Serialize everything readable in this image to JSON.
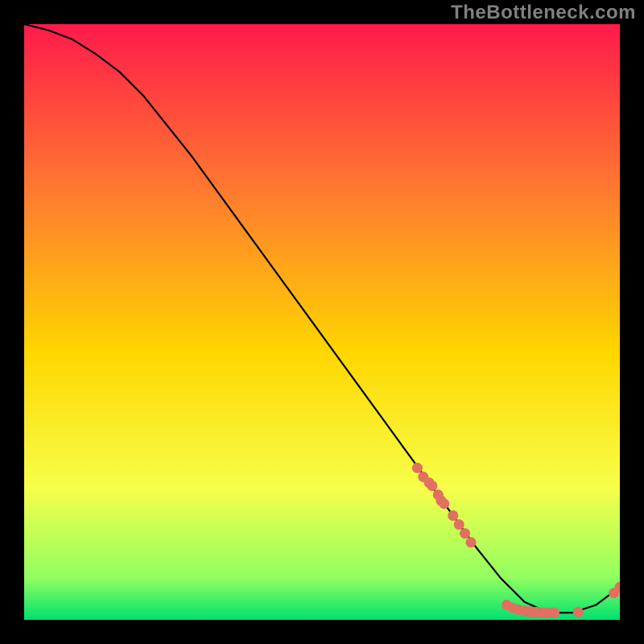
{
  "watermark": "TheBottleneck.com",
  "chart_data": {
    "type": "line",
    "title": "",
    "xlabel": "",
    "ylabel": "",
    "xlim": [
      0,
      100
    ],
    "ylim": [
      0,
      100
    ],
    "grid": false,
    "legend": false,
    "series": [
      {
        "name": "curve",
        "kind": "line",
        "color": "#000000",
        "x": [
          0,
          4,
          8,
          12,
          16,
          20,
          24,
          28,
          32,
          36,
          40,
          44,
          48,
          52,
          56,
          60,
          64,
          68,
          72,
          76,
          80,
          84,
          88,
          92,
          96,
          100
        ],
        "values": [
          100,
          99,
          97.5,
          95,
          92,
          88,
          83,
          78,
          72.5,
          67,
          61.5,
          56,
          50.5,
          45,
          39.5,
          34,
          28.5,
          23,
          17.5,
          12,
          7,
          3,
          1.2,
          1.2,
          2.5,
          5.5
        ]
      },
      {
        "name": "points-descent",
        "kind": "scatter",
        "color": "#E07060",
        "x": [
          66,
          67,
          68,
          68.5,
          69.5,
          70,
          70.5,
          72,
          73,
          74,
          75
        ],
        "values": [
          25.5,
          24,
          23,
          22.5,
          21,
          20,
          19.5,
          17.5,
          16,
          14.5,
          13
        ]
      },
      {
        "name": "points-valley",
        "kind": "scatter",
        "color": "#E07060",
        "x": [
          81,
          82,
          83,
          84,
          84.7,
          85.5,
          86,
          87,
          88,
          89,
          93
        ],
        "values": [
          2.5,
          2.0,
          1.7,
          1.5,
          1.4,
          1.3,
          1.3,
          1.2,
          1.2,
          1.2,
          1.3
        ]
      },
      {
        "name": "points-rise",
        "kind": "scatter",
        "color": "#E07060",
        "x": [
          99,
          100
        ],
        "values": [
          4.5,
          5.5
        ]
      }
    ],
    "background_gradient": {
      "top_color": "#FF1A4A",
      "upper_mid": "#FF7A30",
      "mid_color": "#FFD600",
      "lower_mid": "#F6FF4A",
      "near_bottom": "#90FF60",
      "bottom_color": "#00E070"
    }
  }
}
